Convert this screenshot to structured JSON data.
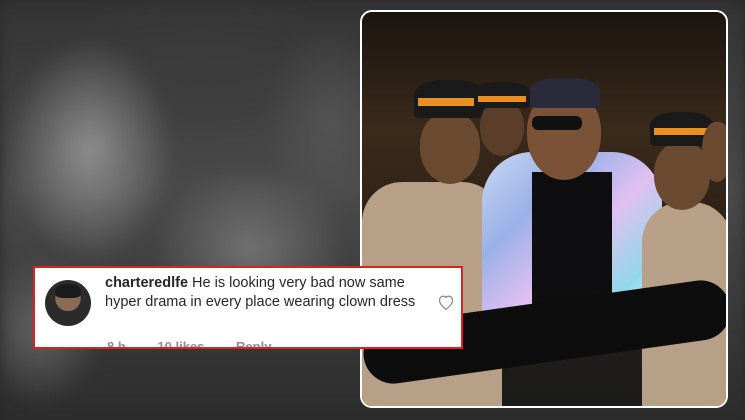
{
  "comment": {
    "username": "charteredlfe",
    "text": "He is looking very bad now same hyper drama in every place wearing clown dress",
    "time": "8 h",
    "likes": "10 likes",
    "reply": "Reply",
    "avatar_icon": "profile-avatar",
    "like_icon": "heart-outline-icon",
    "highlight_color": "#e02020"
  },
  "photo": {
    "description_icon": "celebration-photo"
  }
}
